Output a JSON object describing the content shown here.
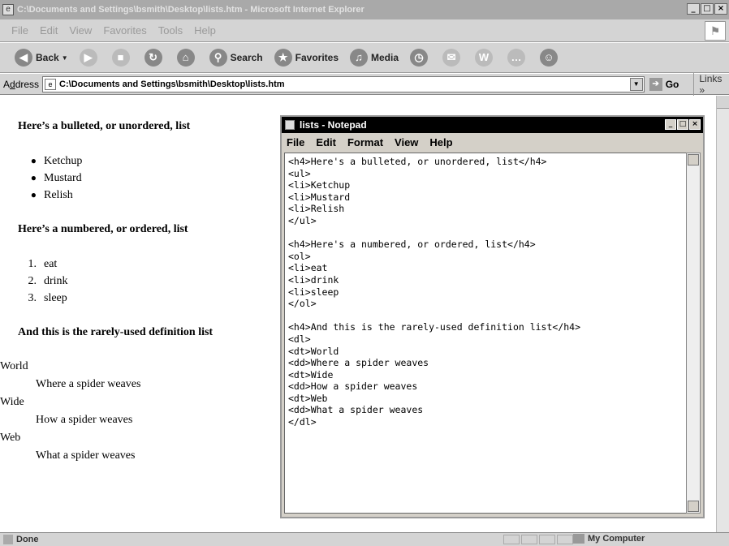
{
  "browser": {
    "title": "C:\\Documents and Settings\\bsmith\\Desktop\\lists.htm - Microsoft Internet Explorer",
    "controls": {
      "minimize": "_",
      "maximize": "□",
      "close": "×"
    },
    "menu": [
      "File",
      "Edit",
      "View",
      "Favorites",
      "Tools",
      "Help"
    ],
    "toolbar": {
      "back": "Back",
      "search": "Search",
      "favorites": "Favorites",
      "media": "Media"
    },
    "address": {
      "label_pre": "A",
      "label_u": "d",
      "label_post": "dress",
      "url": "C:\\Documents and Settings\\bsmith\\Desktop\\lists.htm"
    },
    "go": "Go",
    "links": "Links »",
    "status": {
      "left": "Done",
      "zone": "My Computer"
    }
  },
  "page": {
    "h4_unordered": "Here’s a bulleted, or unordered, list",
    "unordered_items": [
      "Ketchup",
      "Mustard",
      "Relish"
    ],
    "h4_ordered": "Here’s a numbered, or ordered, list",
    "ordered_items": [
      "eat",
      "drink",
      "sleep"
    ],
    "h4_definition": "And this is the rarely-used definition list",
    "definitions": [
      {
        "term": "World",
        "desc": "Where a spider weaves"
      },
      {
        "term": "Wide",
        "desc": "How a spider weaves"
      },
      {
        "term": "Web",
        "desc": "What a spider weaves"
      }
    ]
  },
  "notepad": {
    "title": "lists - Notepad",
    "menu": [
      "File",
      "Edit",
      "Format",
      "View",
      "Help"
    ],
    "lines": [
      "<h4>Here's a bulleted, or unordered, list</h4>",
      "<ul>",
      "<li>Ketchup",
      "<li>Mustard",
      "<li>Relish",
      "</ul>",
      "",
      "<h4>Here's a numbered, or ordered, list</h4>",
      "<ol>",
      "<li>eat",
      "<li>drink",
      "<li>sleep",
      "</ol>",
      "",
      "<h4>And this is the rarely-used definition list</h4>",
      "<dl>",
      "<dt>World",
      "<dd>Where a spider weaves",
      "<dt>Wide",
      "<dd>How a spider weaves",
      "<dt>Web",
      "<dd>What a spider weaves",
      "</dl>"
    ]
  }
}
